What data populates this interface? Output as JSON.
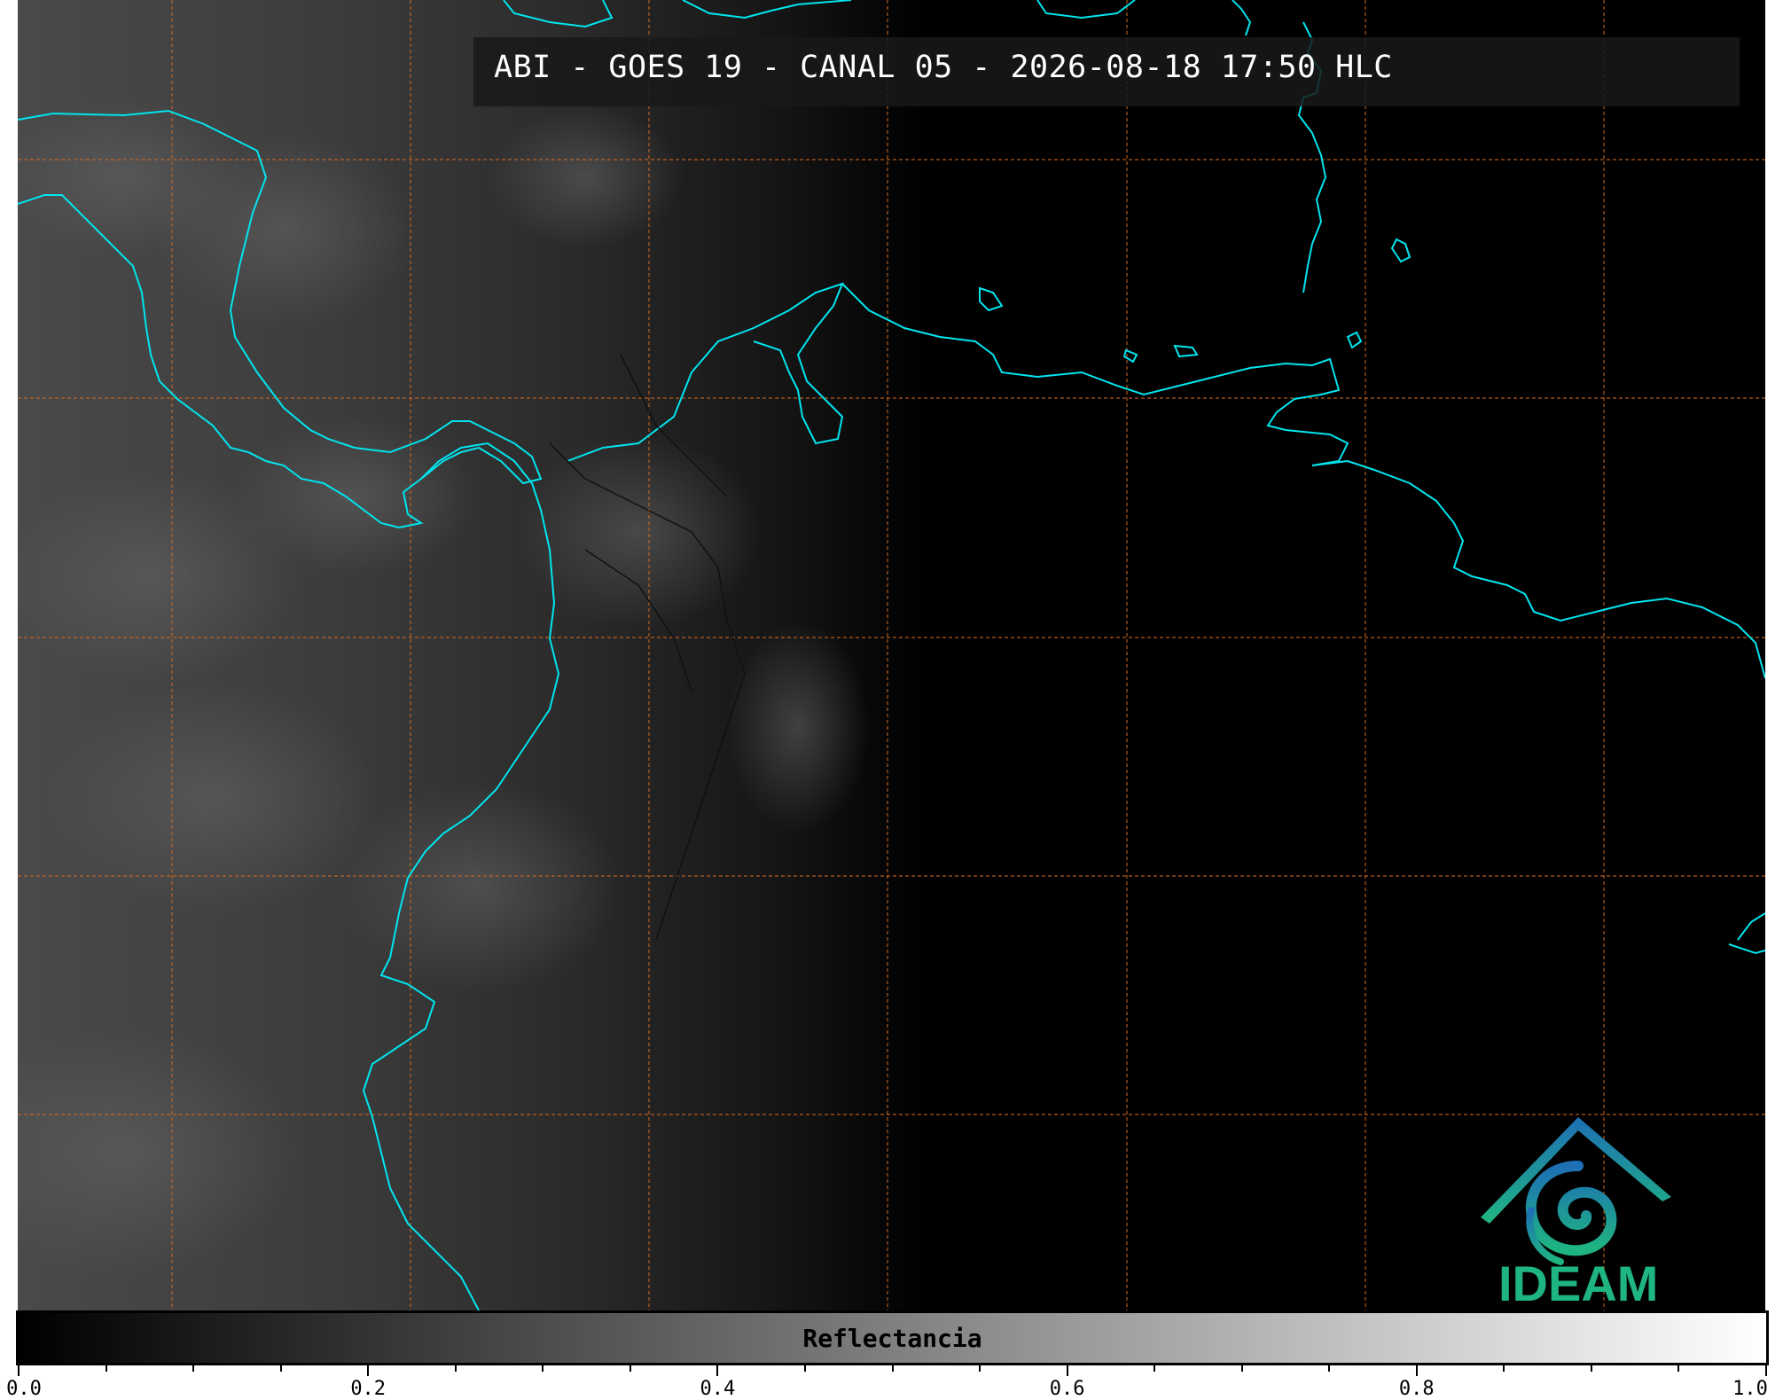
{
  "title": "ABI - GOES 19 - CANAL 05 - 2026-08-18 17:50 HLC",
  "logo": {
    "text": "IDEAM",
    "icon": "ideam-logo-icon"
  },
  "colorbar": {
    "label": "Reflectancia",
    "min": 0.0,
    "max": 1.0,
    "tick_labels": [
      "0.0",
      "0.2",
      "0.4",
      "0.6",
      "0.8",
      "1.0"
    ],
    "color_start": "#000000",
    "color_end": "#ffffff"
  },
  "colors": {
    "coastline": "#00e5ee",
    "graticule": "#d2691e",
    "background": "#000000"
  }
}
